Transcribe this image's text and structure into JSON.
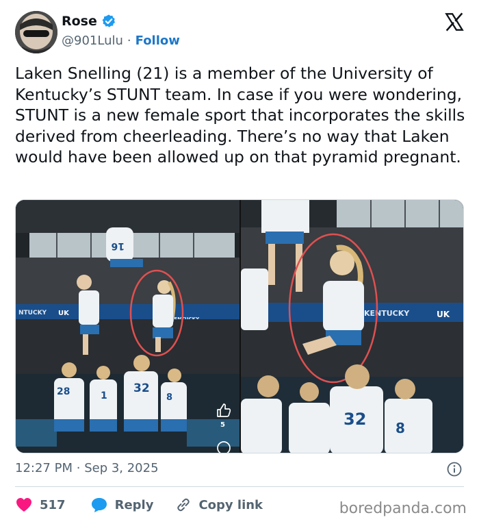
{
  "author": {
    "display_name": "Rose",
    "handle": "@901Lulu",
    "separator": "·",
    "follow_label": "Follow",
    "verified_color": "#1d9bf0"
  },
  "tweet": {
    "text": "Laken Snelling (21) is a member of the University of Kentucky’s STUNT team. In case if you were wondering, STUNT is a new female sport that incorporates the skills derived from cheerleading. There’s no way that Laken would have been allowed up on that pyramid pregnant."
  },
  "media": {
    "left_photo": {
      "banner_text_1": "NTUCKY",
      "banner_text_2": "UK",
      "banner_text_3": "KENTUCKY",
      "jersey_top": "16",
      "jersey_a": "28",
      "jersey_b": "1",
      "jersey_c": "32",
      "jersey_d": "8"
    },
    "right_photo": {
      "banner_text_1": "KENTUCKY",
      "banner_text_2": "UK",
      "jersey_a": "32",
      "jersey_b": "8"
    },
    "like_count": "5",
    "highlight_color": "#e05050"
  },
  "meta": {
    "time": "12:27 PM",
    "separator": "·",
    "date": "Sep 3, 2025"
  },
  "actions": {
    "like_count": "517",
    "reply_label": "Reply",
    "copy_label": "Copy link",
    "like_color": "#f91880",
    "reply_color": "#1d9bf0"
  },
  "watermark": "boredpanda.com"
}
